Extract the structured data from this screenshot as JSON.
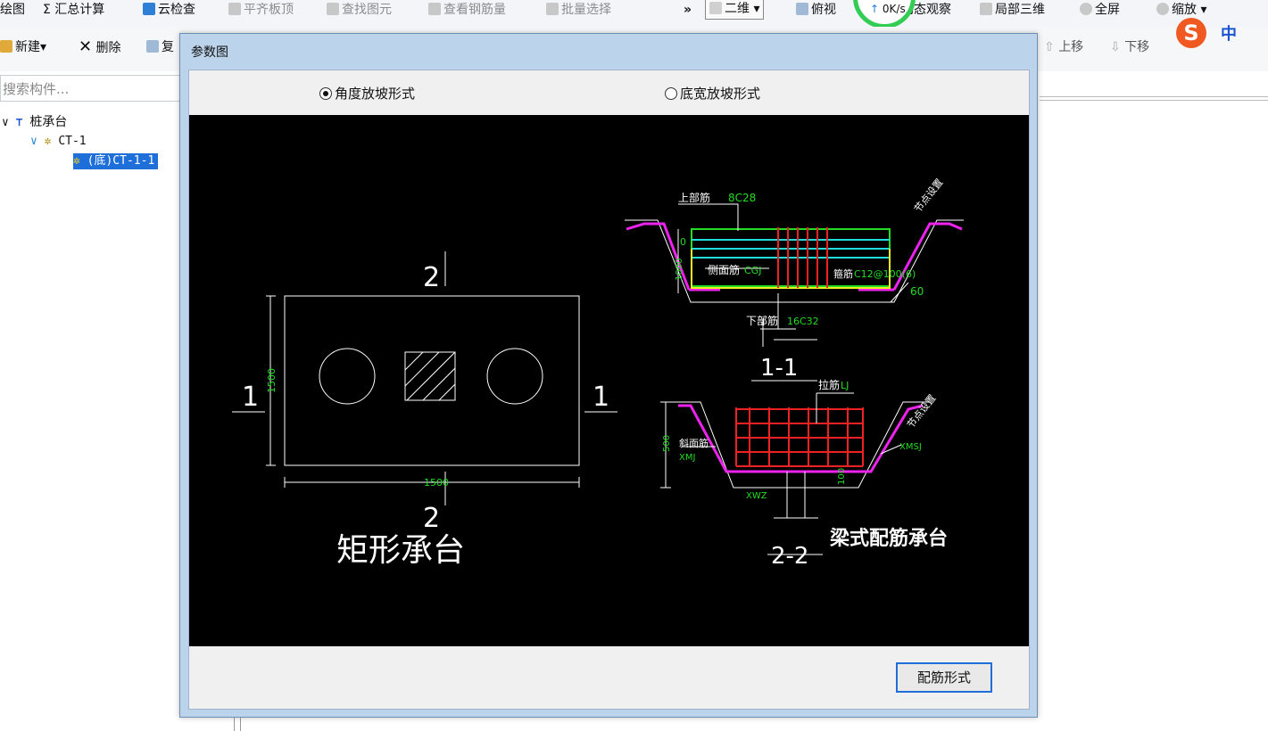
{
  "toolbar": {
    "items": [
      {
        "label": "绘图",
        "dim": false
      },
      {
        "label": "Σ 汇总计算",
        "dim": false
      },
      {
        "label": "云检查",
        "dim": false
      },
      {
        "label": "平齐板顶",
        "dim": true
      },
      {
        "label": "查找图元",
        "dim": true
      },
      {
        "label": "查看钢筋量",
        "dim": true
      },
      {
        "label": "批量选择",
        "dim": true
      },
      {
        "label": "»",
        "dim": false
      },
      {
        "label": "二维 ▾",
        "dim": false
      },
      {
        "label": "俯视",
        "dim": false
      },
      {
        "label": "动态观察",
        "dim": false
      },
      {
        "label": "局部三维",
        "dim": false
      },
      {
        "label": "全屏",
        "dim": false
      },
      {
        "label": "缩放 ▾",
        "dim": false
      }
    ],
    "speed": "0K/s"
  },
  "toolbar2": {
    "new_label": "新建▾",
    "delete_label": "删除",
    "copy_label": "复",
    "up_label": "上移",
    "down_label": "下移",
    "ime_label": "中"
  },
  "sidebar": {
    "search_placeholder": "搜索构件...",
    "tree": [
      {
        "label": "桩承台",
        "level": 0
      },
      {
        "label": "CT-1",
        "level": 1
      },
      {
        "label": "(底)CT-1-1",
        "level": 2,
        "selected": true
      }
    ]
  },
  "dialog": {
    "title": "参数图",
    "radio_angle": "角度放坡形式",
    "radio_width": "底宽放坡形式",
    "button": "配筋形式"
  },
  "drawing": {
    "label_2_top": "2",
    "label_2_bottom": "2",
    "label_1_left": "1",
    "label_1_right": "1",
    "dim_1500_h": "1500",
    "dim_1500_v": "1500",
    "title_rect": "矩形承台",
    "top_rebar": "上部筋",
    "top_rebar_val": "8C28",
    "section_1_1": "1-1",
    "side_rebar": "侧面筋",
    "side_rebar_val": "CGJ",
    "stirrup": "箍筋",
    "stirrup_val": "C12@100(6)",
    "bottom_rebar": "下部筋",
    "bottom_rebar_val": "16C32",
    "angle": "60",
    "node_setting": "节点设置",
    "zero": "0",
    "dim_1000": "1000",
    "tie": "拉筋",
    "tie_val": "LJ",
    "dim_500": "500",
    "slope_rebar": "斜面筋",
    "slope_rebar_val": "XMJ",
    "xmsj": "XMSJ",
    "xwz": "XWZ",
    "dim_100": "100",
    "section_2_2": "2-2",
    "title_beam": "梁式配筋承台"
  }
}
